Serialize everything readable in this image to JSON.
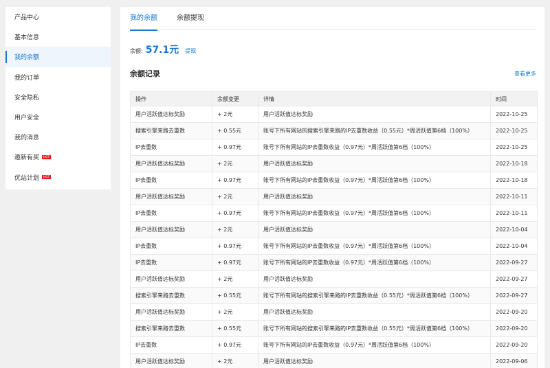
{
  "sidebar": {
    "items": [
      {
        "label": "产品中心",
        "active": false
      },
      {
        "label": "基本信息",
        "active": false
      },
      {
        "label": "我的余额",
        "active": true
      },
      {
        "label": "我的订单",
        "active": false
      },
      {
        "label": "安全隐私",
        "active": false
      },
      {
        "label": "用户安全",
        "active": false
      },
      {
        "label": "我的消息",
        "active": false
      },
      {
        "label": "邀新有奖",
        "active": false,
        "badge": "HOT"
      },
      {
        "label": "优站计划",
        "active": false,
        "badge": "HOT"
      }
    ]
  },
  "tabs": [
    {
      "label": "我的余额",
      "active": true
    },
    {
      "label": "余额提现",
      "active": false
    }
  ],
  "balance": {
    "label": "余额:",
    "amount": "57.1元",
    "withdraw_label": "提现"
  },
  "records": {
    "title": "余额记录",
    "see_more": "查看更多",
    "columns": [
      "操作",
      "余额变更",
      "详情",
      "时间"
    ],
    "rows": [
      [
        "用户活跃值达标奖励",
        "+ 2元",
        "用户活跃值达标奖励",
        "2022-10-25"
      ],
      [
        "搜索引擎来路去重数",
        "+ 0.55元",
        "账号下所有网站的搜索引擎来路的IP去重数收益（0.55元）*周活跃值第6档（100%）",
        "2022-10-25"
      ],
      [
        "IP去重数",
        "+ 0.97元",
        "账号下所有网站的IP去重数收益（0.97元）*周活跃值第6档（100%）",
        "2022-10-25"
      ],
      [
        "用户活跃值达标奖励",
        "+ 2元",
        "用户活跃值达标奖励",
        "2022-10-18"
      ],
      [
        "IP去重数",
        "+ 0.97元",
        "账号下所有网站的IP去重数收益（0.97元）*周活跃值第6档（100%）",
        "2022-10-18"
      ],
      [
        "用户活跃值达标奖励",
        "+ 2元",
        "用户活跃值达标奖励",
        "2022-10-11"
      ],
      [
        "IP去重数",
        "+ 0.97元",
        "账号下所有网站的IP去重数收益（0.97元）*周活跃值第6档（100%）",
        "2022-10-11"
      ],
      [
        "用户活跃值达标奖励",
        "+ 2元",
        "用户活跃值达标奖励",
        "2022-10-04"
      ],
      [
        "IP去重数",
        "+ 0.97元",
        "账号下所有网站的IP去重数收益（0.97元）*周活跃值第6档（100%）",
        "2022-10-04"
      ],
      [
        "IP去重数",
        "+ 0.97元",
        "账号下所有网站的IP去重数收益（0.97元）*周活跃值第6档（100%）",
        "2022-09-27"
      ],
      [
        "用户活跃值达标奖励",
        "+ 2元",
        "用户活跃值达标奖励",
        "2022-09-27"
      ],
      [
        "搜索引擎来路去重数",
        "+ 0.55元",
        "账号下所有网站的搜索引擎来路的IP去重数收益（0.55元）*周活跃值第6档（100%）",
        "2022-09-27"
      ],
      [
        "用户活跃值达标奖励",
        "+ 2元",
        "用户活跃值达标奖励",
        "2022-09-20"
      ],
      [
        "搜索引擎来路去重数",
        "+ 0.55元",
        "账号下所有网站的搜索引擎来路的IP去重数收益（0.55元）*周活跃值第6档（100%）",
        "2022-09-20"
      ],
      [
        "IP去重数",
        "+ 0.97元",
        "账号下所有网站的IP去重数收益（0.97元）*周活跃值第6档（100%）",
        "2022-09-20"
      ],
      [
        "用户活跃值达标奖励",
        "+ 2元",
        "用户活跃值达标奖励",
        "2022-09-06"
      ]
    ]
  },
  "colors": {
    "accent": "#1677d2",
    "badge": "#e02020",
    "page_bg": "#f0f0f0"
  }
}
